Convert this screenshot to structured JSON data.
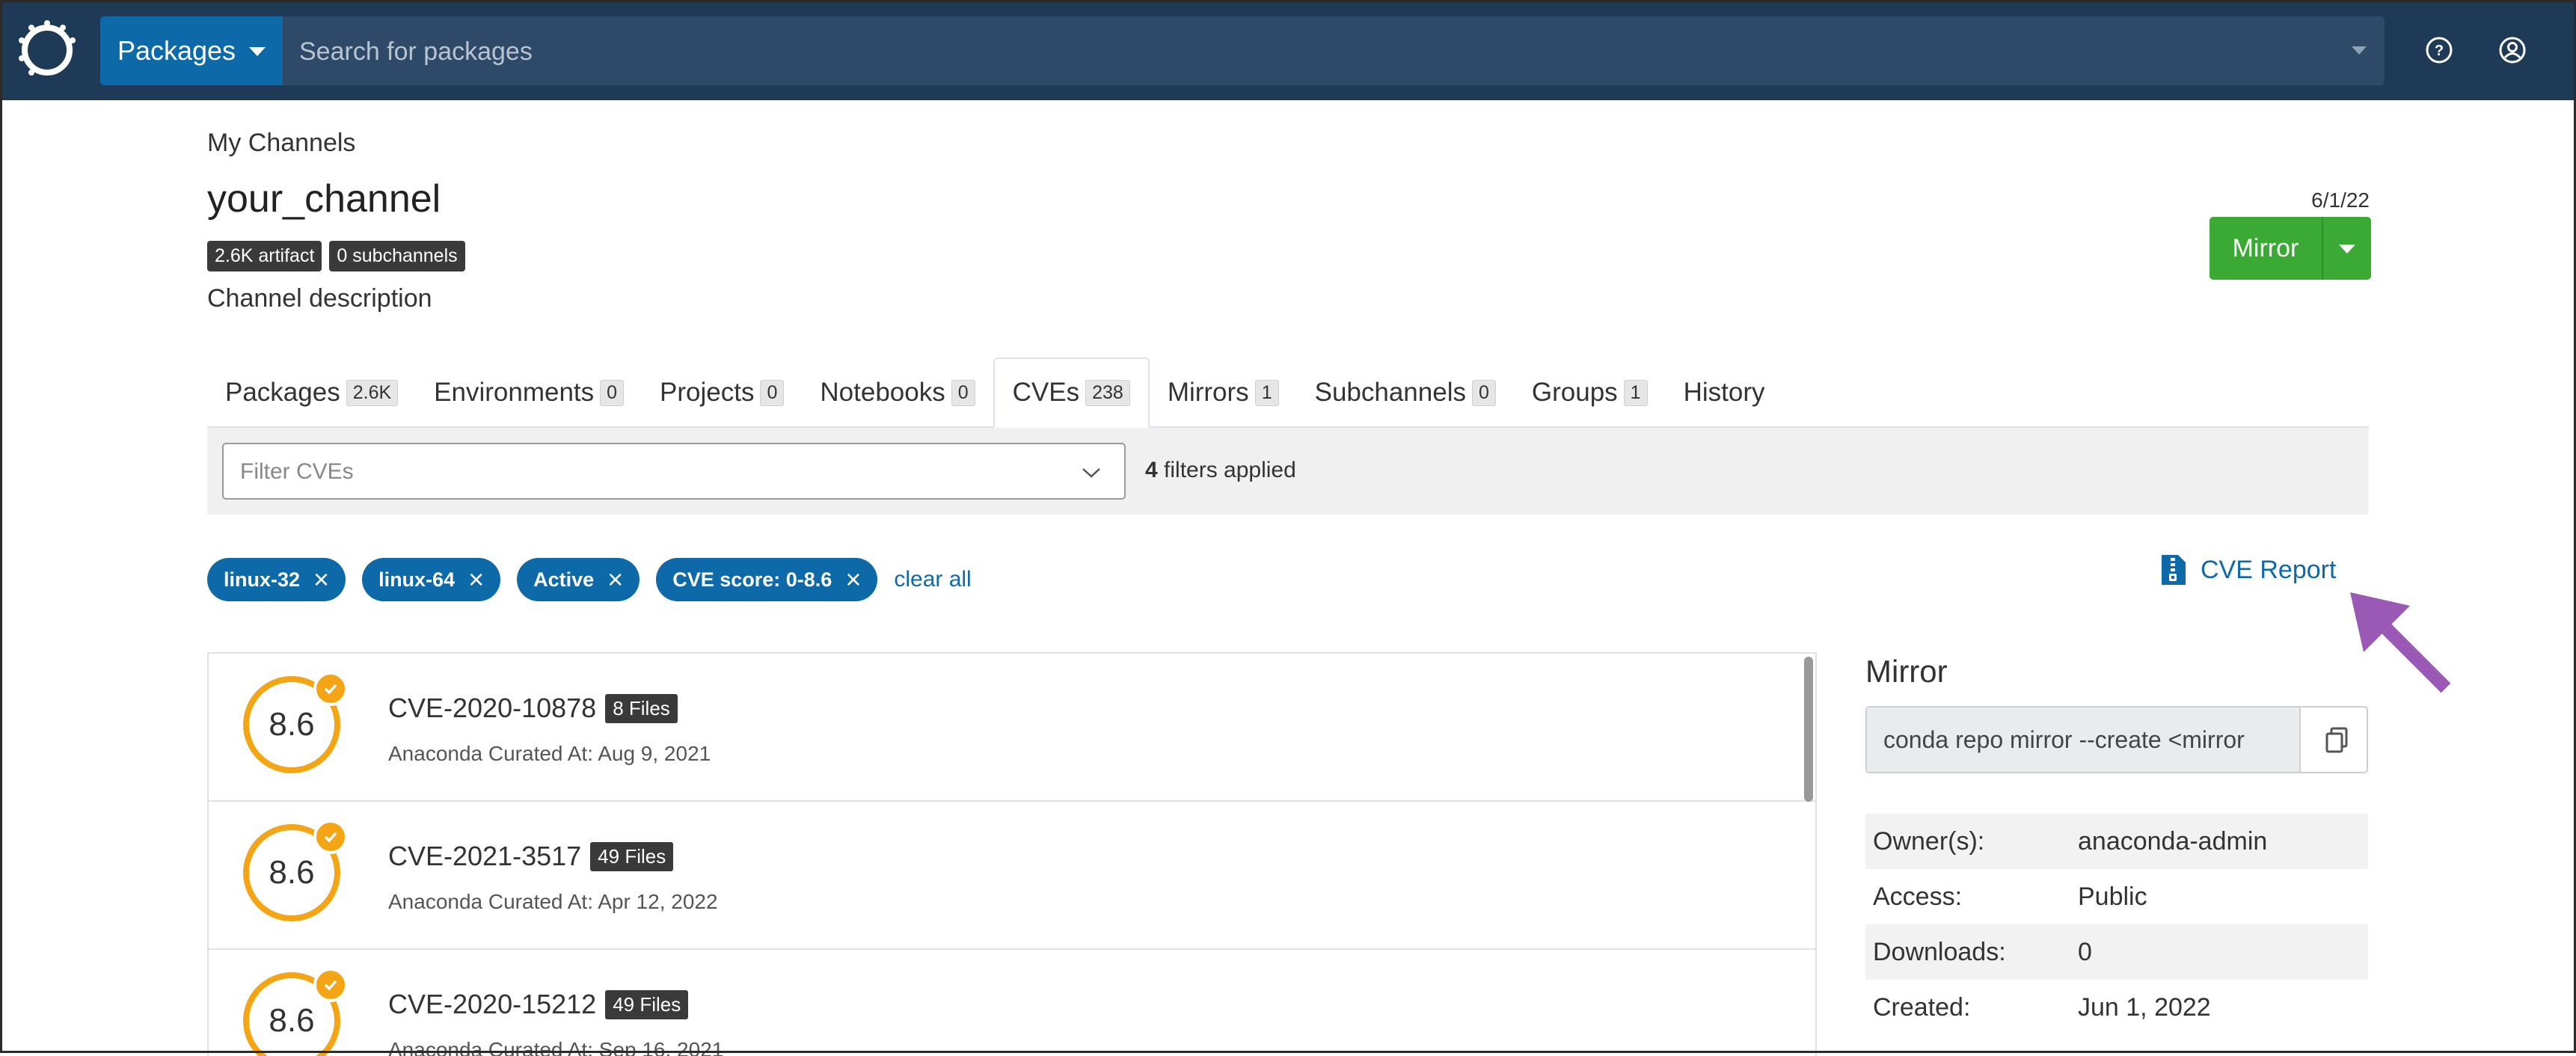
{
  "navbar": {
    "packages_label": "Packages",
    "search_placeholder": "Search for packages"
  },
  "header": {
    "breadcrumb": "My Channels",
    "channel_name": "your_channel",
    "badges": [
      "2.6K artifact",
      "0 subchannels"
    ],
    "description": "Channel description",
    "date": "6/1/22",
    "mirror_button": "Mirror"
  },
  "tabs": [
    {
      "label": "Packages",
      "count": "2.6K"
    },
    {
      "label": "Environments",
      "count": "0"
    },
    {
      "label": "Projects",
      "count": "0"
    },
    {
      "label": "Notebooks",
      "count": "0"
    },
    {
      "label": "CVEs",
      "count": "238",
      "active": true
    },
    {
      "label": "Mirrors",
      "count": "1"
    },
    {
      "label": "Subchannels",
      "count": "0"
    },
    {
      "label": "Groups",
      "count": "1"
    },
    {
      "label": "History",
      "count": ""
    }
  ],
  "filters": {
    "placeholder": "Filter CVEs",
    "applied_count": "4",
    "applied_text": "filters applied",
    "pills": [
      "linux-32",
      "linux-64",
      "Active",
      "CVE score: 0-8.6"
    ],
    "clear_all": "clear all",
    "cve_report": "CVE Report"
  },
  "cves": [
    {
      "id": "CVE-2020-10878",
      "files": "8 Files",
      "score": "8.6",
      "curated": "Anaconda Curated At: Aug 9, 2021"
    },
    {
      "id": "CVE-2021-3517",
      "files": "49 Files",
      "score": "8.6",
      "curated": "Anaconda Curated At: Apr 12, 2022"
    },
    {
      "id": "CVE-2020-15212",
      "files": "49 Files",
      "score": "8.6",
      "curated": "Anaconda Curated At: Sep 16, 2021"
    }
  ],
  "panel": {
    "title": "Mirror",
    "command": "conda repo mirror --create <mirror",
    "details": [
      {
        "key": "Owner(s):",
        "value": "anaconda-admin"
      },
      {
        "key": "Access:",
        "value": "Public"
      },
      {
        "key": "Downloads:",
        "value": "0"
      },
      {
        "key": "Created:",
        "value": "Jun 1, 2022"
      }
    ]
  },
  "colors": {
    "navbar": "#1e3a56",
    "accent_blue": "#0d69a7",
    "mirror_green": "#3aaa35",
    "score_orange": "#f3a516",
    "arrow_purple": "#9b59b6"
  }
}
